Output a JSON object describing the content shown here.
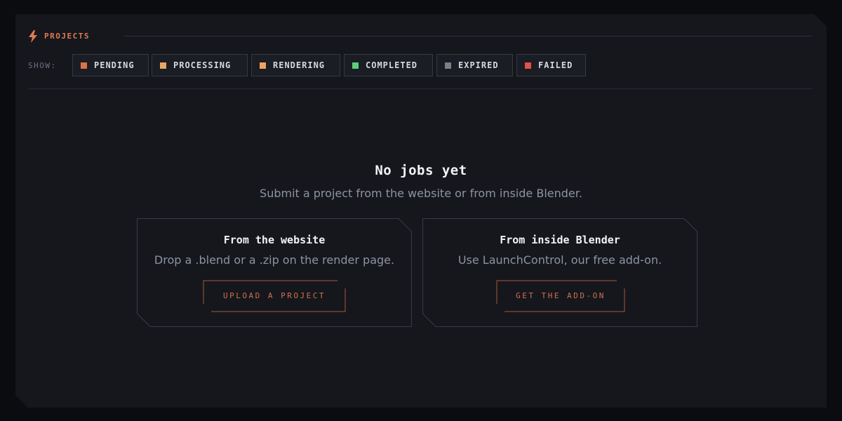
{
  "header": {
    "title": "PROJECTS",
    "icon": "bolt-icon",
    "accent_color": "#e07a52"
  },
  "filters": {
    "show_label": "SHOW:",
    "chips": [
      {
        "label": "PENDING",
        "color": "#e0704a"
      },
      {
        "label": "PROCESSING",
        "color": "#e9a765"
      },
      {
        "label": "RENDERING",
        "color": "#eba45f"
      },
      {
        "label": "COMPLETED",
        "color": "#5ccf7a"
      },
      {
        "label": "EXPIRED",
        "color": "#7a7f8c"
      },
      {
        "label": "FAILED",
        "color": "#e05148"
      }
    ]
  },
  "empty_state": {
    "title": "No jobs yet",
    "subtitle": "Submit a project from the website or from inside Blender."
  },
  "cards": [
    {
      "title": "From the website",
      "description": "Drop a .blend or a .zip on the render page.",
      "button_label": "UPLOAD A PROJECT"
    },
    {
      "title": "From inside Blender",
      "description": "Use LaunchControl, our free add-on.",
      "button_label": "GET THE ADD-ON"
    }
  ]
}
